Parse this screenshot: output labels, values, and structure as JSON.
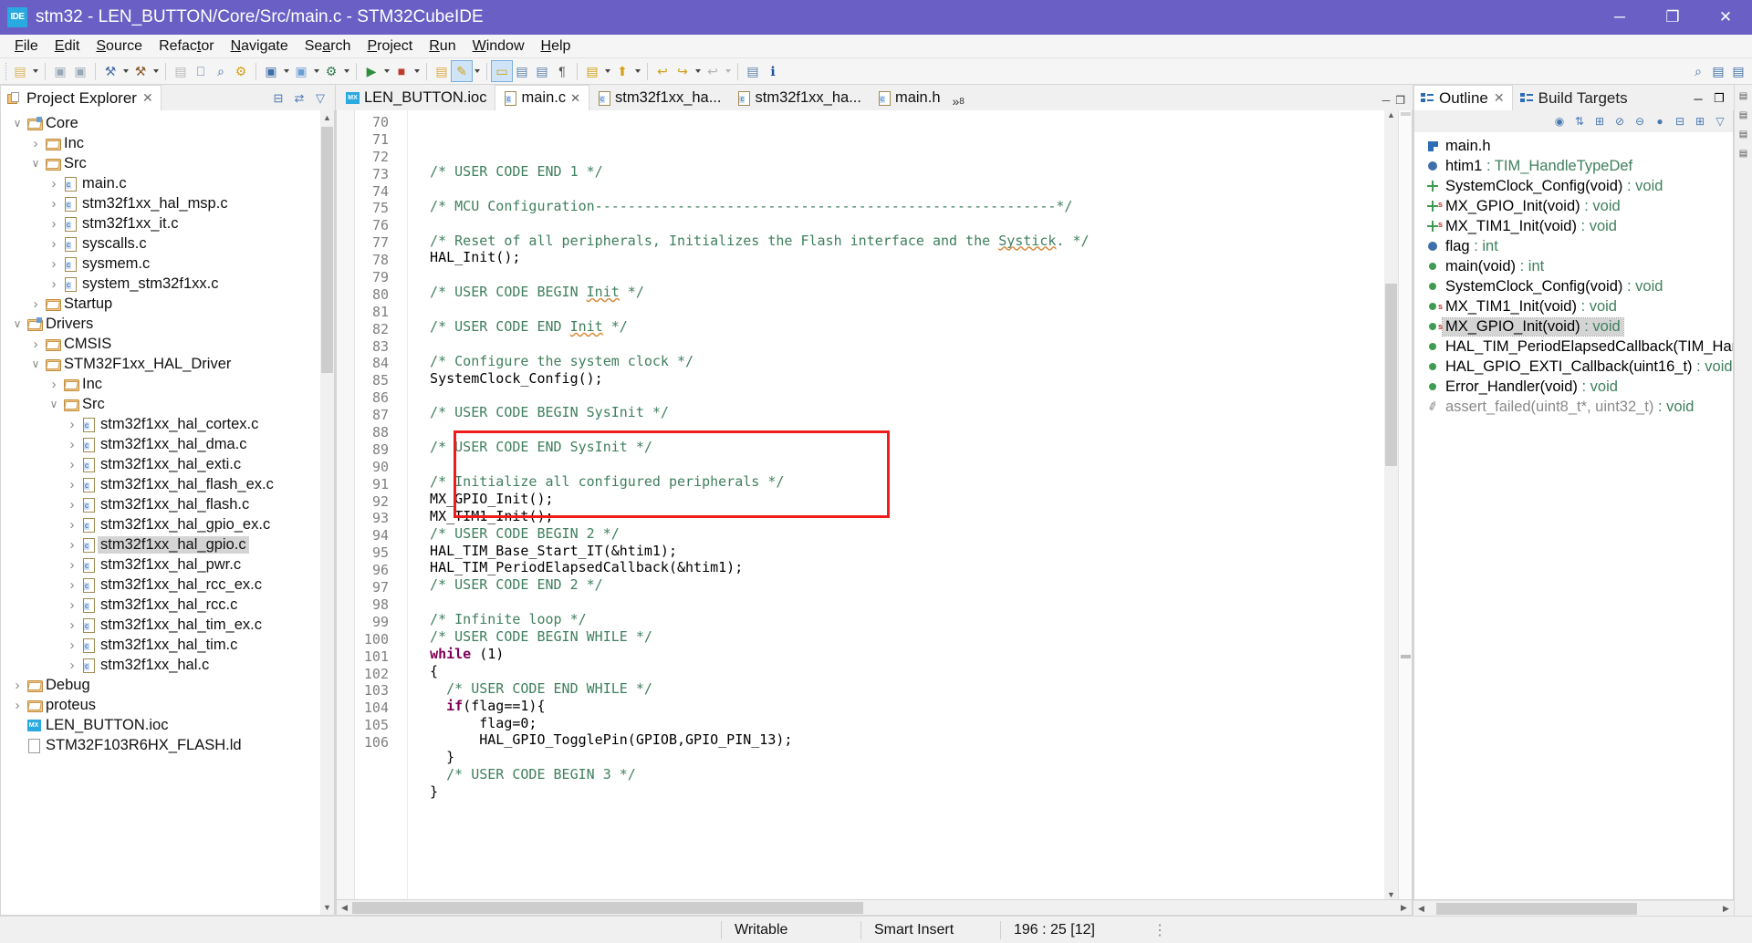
{
  "window": {
    "title": "stm32 - LEN_BUTTON/Core/Src/main.c - STM32CubeIDE",
    "logo_text": "IDE",
    "minimize": "─",
    "maximize": "❐",
    "close": "✕"
  },
  "menubar": [
    {
      "label": "File",
      "mnemonic": "F"
    },
    {
      "label": "Edit",
      "mnemonic": "E"
    },
    {
      "label": "Source",
      "mnemonic": "S"
    },
    {
      "label": "Refactor",
      "mnemonic": "t"
    },
    {
      "label": "Navigate",
      "mnemonic": "N"
    },
    {
      "label": "Search",
      "mnemonic": "a"
    },
    {
      "label": "Project",
      "mnemonic": "P"
    },
    {
      "label": "Run",
      "mnemonic": "R"
    },
    {
      "label": "Window",
      "mnemonic": "W"
    },
    {
      "label": "Help",
      "mnemonic": "H"
    }
  ],
  "toolbar": {
    "items": [
      {
        "name": "new-c-c++-project",
        "glyph": "▤",
        "color": "#d9b35c",
        "arrow": true
      },
      {
        "name": "save",
        "glyph": "▣",
        "color": "#9aa7b5",
        "arrow": false
      },
      {
        "name": "save-all",
        "glyph": "▣",
        "color": "#9aa7b5",
        "arrow": false
      },
      {
        "name": "build-all",
        "glyph": "⚒",
        "color": "#4a6fa5",
        "arrow": true
      },
      {
        "name": "build-hammer",
        "glyph": "⚒",
        "color": "#8a5a2b",
        "arrow": true
      },
      {
        "name": "new-file",
        "glyph": "▤",
        "color": "#b7b7b7",
        "arrow": false
      },
      {
        "name": "binary-010",
        "glyph": "⎕",
        "color": "#5577aa",
        "arrow": false
      },
      {
        "name": "search",
        "glyph": "⌕",
        "color": "#3f6fa8",
        "arrow": false
      },
      {
        "name": "build-config",
        "glyph": "⚙",
        "color": "#d4a017",
        "arrow": false
      },
      {
        "name": "open-element",
        "glyph": "▣",
        "color": "#3f6fa8",
        "arrow": true
      },
      {
        "name": "debug-config",
        "glyph": "▣",
        "color": "#6b9fd4",
        "arrow": true
      },
      {
        "name": "debug-bug",
        "glyph": "⚙",
        "color": "#2f7d4f",
        "arrow": true
      },
      {
        "name": "run",
        "glyph": "▶",
        "color": "#2f8f3f",
        "arrow": true
      },
      {
        "name": "stop",
        "glyph": "■",
        "color": "#c0392b",
        "arrow": true
      },
      {
        "name": "open-folder",
        "glyph": "▤",
        "color": "#e0a93f",
        "arrow": false
      },
      {
        "name": "pencil-edit",
        "glyph": "✎",
        "color": "#d4a017",
        "arrow": true
      },
      {
        "name": "toggle-comment",
        "glyph": "▭",
        "color": "#d4a017",
        "arrow": false
      },
      {
        "name": "next-annotation",
        "glyph": "▤",
        "color": "#5b7fa8",
        "arrow": false
      },
      {
        "name": "prev-annotation",
        "glyph": "▤",
        "color": "#5b7fa8",
        "arrow": false
      },
      {
        "name": "show-whitespace",
        "glyph": "¶",
        "color": "#555",
        "arrow": false
      },
      {
        "name": "skip-breakpoints",
        "glyph": "▤",
        "color": "#d4a017",
        "arrow": true
      },
      {
        "name": "resume",
        "glyph": "⬆",
        "color": "#d4a017",
        "arrow": true
      },
      {
        "name": "back-nav",
        "glyph": "↩",
        "color": "#d4a017",
        "arrow": false
      },
      {
        "name": "forward-nav",
        "glyph": "↪",
        "color": "#d4a017",
        "arrow": true
      },
      {
        "name": "last-edit",
        "glyph": "↩",
        "color": "#b5b5b5",
        "arrow": true
      },
      {
        "name": "pin-editor",
        "glyph": "▤",
        "color": "#5b7fa8",
        "arrow": false
      },
      {
        "name": "information",
        "glyph": "ℹ",
        "color": "#1b4f9c",
        "arrow": false
      }
    ],
    "right_items": [
      {
        "name": "quick-access-search",
        "glyph": "⌕"
      },
      {
        "name": "perspective-c-cpp",
        "glyph": "▤"
      },
      {
        "name": "perspective-open",
        "glyph": "▤"
      }
    ]
  },
  "explorer": {
    "tab_label": "Project Explorer",
    "tab_close": "✕",
    "tools": [
      {
        "name": "collapse-all-icon",
        "glyph": "⊟"
      },
      {
        "name": "link-with-editor-icon",
        "glyph": "⇄"
      },
      {
        "name": "view-menu-filter-icon",
        "glyph": "▽"
      }
    ],
    "tree": [
      {
        "depth": 0,
        "arrow": "open",
        "icon": "project-folder",
        "label": "Core",
        "selected": false
      },
      {
        "depth": 1,
        "arrow": "closed",
        "icon": "folder",
        "label": "Inc",
        "selected": false
      },
      {
        "depth": 1,
        "arrow": "open",
        "icon": "folder",
        "label": "Src",
        "selected": false
      },
      {
        "depth": 2,
        "arrow": "closed",
        "icon": "cfile",
        "label": "main.c",
        "selected": false
      },
      {
        "depth": 2,
        "arrow": "closed",
        "icon": "cfile",
        "label": "stm32f1xx_hal_msp.c",
        "selected": false
      },
      {
        "depth": 2,
        "arrow": "closed",
        "icon": "cfile",
        "label": "stm32f1xx_it.c",
        "selected": false
      },
      {
        "depth": 2,
        "arrow": "closed",
        "icon": "cfile",
        "label": "syscalls.c",
        "selected": false
      },
      {
        "depth": 2,
        "arrow": "closed",
        "icon": "cfile",
        "label": "sysmem.c",
        "selected": false
      },
      {
        "depth": 2,
        "arrow": "closed",
        "icon": "cfile",
        "label": "system_stm32f1xx.c",
        "selected": false
      },
      {
        "depth": 1,
        "arrow": "closed",
        "icon": "folder",
        "label": "Startup",
        "selected": false
      },
      {
        "depth": 0,
        "arrow": "open",
        "icon": "project-folder",
        "label": "Drivers",
        "selected": false
      },
      {
        "depth": 1,
        "arrow": "closed",
        "icon": "folder",
        "label": "CMSIS",
        "selected": false
      },
      {
        "depth": 1,
        "arrow": "open",
        "icon": "folder",
        "label": "STM32F1xx_HAL_Driver",
        "selected": false
      },
      {
        "depth": 2,
        "arrow": "closed",
        "icon": "folder",
        "label": "Inc",
        "selected": false
      },
      {
        "depth": 2,
        "arrow": "open",
        "icon": "folder",
        "label": "Src",
        "selected": false
      },
      {
        "depth": 3,
        "arrow": "closed",
        "icon": "cfile",
        "label": "stm32f1xx_hal_cortex.c",
        "selected": false
      },
      {
        "depth": 3,
        "arrow": "closed",
        "icon": "cfile",
        "label": "stm32f1xx_hal_dma.c",
        "selected": false
      },
      {
        "depth": 3,
        "arrow": "closed",
        "icon": "cfile",
        "label": "stm32f1xx_hal_exti.c",
        "selected": false
      },
      {
        "depth": 3,
        "arrow": "closed",
        "icon": "cfile",
        "label": "stm32f1xx_hal_flash_ex.c",
        "selected": false
      },
      {
        "depth": 3,
        "arrow": "closed",
        "icon": "cfile",
        "label": "stm32f1xx_hal_flash.c",
        "selected": false
      },
      {
        "depth": 3,
        "arrow": "closed",
        "icon": "cfile",
        "label": "stm32f1xx_hal_gpio_ex.c",
        "selected": false
      },
      {
        "depth": 3,
        "arrow": "closed",
        "icon": "cfile",
        "label": "stm32f1xx_hal_gpio.c",
        "selected": true
      },
      {
        "depth": 3,
        "arrow": "closed",
        "icon": "cfile",
        "label": "stm32f1xx_hal_pwr.c",
        "selected": false
      },
      {
        "depth": 3,
        "arrow": "closed",
        "icon": "cfile",
        "label": "stm32f1xx_hal_rcc_ex.c",
        "selected": false
      },
      {
        "depth": 3,
        "arrow": "closed",
        "icon": "cfile",
        "label": "stm32f1xx_hal_rcc.c",
        "selected": false
      },
      {
        "depth": 3,
        "arrow": "closed",
        "icon": "cfile",
        "label": "stm32f1xx_hal_tim_ex.c",
        "selected": false
      },
      {
        "depth": 3,
        "arrow": "closed",
        "icon": "cfile",
        "label": "stm32f1xx_hal_tim.c",
        "selected": false
      },
      {
        "depth": 3,
        "arrow": "closed",
        "icon": "cfile",
        "label": "stm32f1xx_hal.c",
        "selected": false
      },
      {
        "depth": 0,
        "arrow": "closed",
        "icon": "folder",
        "label": "Debug",
        "selected": false
      },
      {
        "depth": 0,
        "arrow": "closed",
        "icon": "folder",
        "label": "proteus",
        "selected": false
      },
      {
        "depth": 0,
        "arrow": "none",
        "icon": "ioc",
        "label": "LEN_BUTTON.ioc",
        "selected": false
      },
      {
        "depth": 0,
        "arrow": "none",
        "icon": "gfile",
        "label": "STM32F103R6HX_FLASH.ld",
        "selected": false
      }
    ]
  },
  "editor": {
    "tabs": [
      {
        "label": "LEN_BUTTON.ioc",
        "icon": "ioc",
        "active": false,
        "dirty": false
      },
      {
        "label": "main.c",
        "icon": "cfile",
        "active": true,
        "dirty": false
      },
      {
        "label": "stm32f1xx_ha...",
        "icon": "cfile",
        "active": false,
        "dirty": false
      },
      {
        "label": "stm32f1xx_ha...",
        "icon": "cfile",
        "active": false,
        "dirty": false
      },
      {
        "label": "main.h",
        "icon": "cfile",
        "active": false,
        "dirty": false
      }
    ],
    "overflow_label": "»",
    "overflow_count": "8",
    "view_tools": [
      {
        "name": "minimize-editor-icon",
        "glyph": "─"
      },
      {
        "name": "maximize-editor-icon",
        "glyph": "❐"
      }
    ],
    "first_line": 70,
    "lines": [
      {
        "n": 70,
        "text": "  /* USER CODE END 1 */",
        "style": "comment"
      },
      {
        "n": 71,
        "text": "",
        "style": "plain"
      },
      {
        "n": 72,
        "text": "  /* MCU Configuration--------------------------------------------------------*/",
        "style": "comment"
      },
      {
        "n": 73,
        "text": "",
        "style": "plain"
      },
      {
        "n": 74,
        "text": "  /* Reset of all peripherals, Initializes the Flash interface and the Systick. */",
        "style": "comment-systick"
      },
      {
        "n": 75,
        "text": "  HAL_Init();",
        "style": "plain"
      },
      {
        "n": 76,
        "text": "",
        "style": "plain"
      },
      {
        "n": 77,
        "text": "  /* USER CODE BEGIN Init */",
        "style": "comment-init"
      },
      {
        "n": 78,
        "text": "",
        "style": "plain"
      },
      {
        "n": 79,
        "text": "  /* USER CODE END Init */",
        "style": "comment-init"
      },
      {
        "n": 80,
        "text": "",
        "style": "plain"
      },
      {
        "n": 81,
        "text": "  /* Configure the system clock */",
        "style": "comment"
      },
      {
        "n": 82,
        "text": "  SystemClock_Config();",
        "style": "plain"
      },
      {
        "n": 83,
        "text": "",
        "style": "plain"
      },
      {
        "n": 84,
        "text": "  /* USER CODE BEGIN SysInit */",
        "style": "comment"
      },
      {
        "n": 85,
        "text": "",
        "style": "plain"
      },
      {
        "n": 86,
        "text": "  /* USER CODE END SysInit */",
        "style": "comment"
      },
      {
        "n": 87,
        "text": "",
        "style": "plain"
      },
      {
        "n": 88,
        "text": "  /* Initialize all configured peripherals */",
        "style": "comment"
      },
      {
        "n": 89,
        "text": "  MX_GPIO_Init();",
        "style": "plain"
      },
      {
        "n": 90,
        "text": "  MX_TIM1_Init();",
        "style": "plain"
      },
      {
        "n": 91,
        "text": "  /* USER CODE BEGIN 2 */",
        "style": "comment"
      },
      {
        "n": 92,
        "text": "  HAL_TIM_Base_Start_IT(&htim1);",
        "style": "plain"
      },
      {
        "n": 93,
        "text": "  HAL_TIM_PeriodElapsedCallback(&htim1);",
        "style": "plain"
      },
      {
        "n": 94,
        "text": "  /* USER CODE END 2 */",
        "style": "comment"
      },
      {
        "n": 95,
        "text": "",
        "style": "plain"
      },
      {
        "n": 96,
        "text": "  /* Infinite loop */",
        "style": "comment"
      },
      {
        "n": 97,
        "text": "  /* USER CODE BEGIN WHILE */",
        "style": "comment"
      },
      {
        "n": 98,
        "text": "  while (1)",
        "style": "keyword-while"
      },
      {
        "n": 99,
        "text": "  {",
        "style": "plain"
      },
      {
        "n": 100,
        "text": "    /* USER CODE END WHILE */",
        "style": "comment"
      },
      {
        "n": 101,
        "text": "    if(flag==1){",
        "style": "keyword-if"
      },
      {
        "n": 102,
        "text": "        flag=0;",
        "style": "plain"
      },
      {
        "n": 103,
        "text": "        HAL_GPIO_TogglePin(GPIOB,GPIO_PIN_13);",
        "style": "plain"
      },
      {
        "n": 104,
        "text": "    }",
        "style": "plain"
      },
      {
        "n": 105,
        "text": "    /* USER CODE BEGIN 3 */",
        "style": "comment"
      },
      {
        "n": 106,
        "text": "  }",
        "style": "plain"
      }
    ],
    "annotation": {
      "name": "red-highlight-box",
      "color": "#ee1c1c",
      "covers_lines": "101-105"
    }
  },
  "outline": {
    "tabs": [
      {
        "label": "Outline",
        "active": true,
        "icon": "outline-icon",
        "close": "✕"
      },
      {
        "label": "Build Targets",
        "active": false,
        "icon": "build-targets-icon",
        "close": ""
      }
    ],
    "tools": [
      {
        "name": "minimize-outline-icon",
        "glyph": "─"
      },
      {
        "name": "maximize-outline-icon",
        "glyph": "❐"
      }
    ],
    "toolbar_icons": [
      {
        "name": "focus-on-active-task-icon",
        "glyph": "◉"
      },
      {
        "name": "sort-icon",
        "glyph": "⇅"
      },
      {
        "name": "hide-fields-icon",
        "glyph": "⊞"
      },
      {
        "name": "hide-static-icon",
        "glyph": "⊘"
      },
      {
        "name": "hide-non-public-icon",
        "glyph": "⊖"
      },
      {
        "name": "show-groups-icon",
        "glyph": "●"
      },
      {
        "name": "collapse-all-icon",
        "glyph": "⊟"
      },
      {
        "name": "expand-all-icon",
        "glyph": "⊞"
      },
      {
        "name": "view-menu-icon",
        "glyph": "▽"
      }
    ],
    "items": [
      {
        "icon": "include",
        "name_text": "main.h",
        "type_text": "",
        "static": false,
        "selected": false
      },
      {
        "icon": "variable-blue",
        "name_text": "htim1 ",
        "type_text": ": TIM_HandleTypeDef",
        "static": false,
        "selected": false
      },
      {
        "icon": "prototype",
        "name_text": "SystemClock_Config(void) ",
        "type_text": ": void",
        "static": false,
        "selected": false
      },
      {
        "icon": "prototype",
        "name_text": "MX_GPIO_Init(void) ",
        "type_text": ": void",
        "static": true,
        "selected": false
      },
      {
        "icon": "prototype",
        "name_text": "MX_TIM1_Init(void) ",
        "type_text": ": void",
        "static": true,
        "selected": false
      },
      {
        "icon": "variable-blue",
        "name_text": "flag ",
        "type_text": ": int",
        "static": false,
        "selected": false
      },
      {
        "icon": "function-green",
        "name_text": "main(void) ",
        "type_text": ": int",
        "static": false,
        "selected": false
      },
      {
        "icon": "function-green",
        "name_text": "SystemClock_Config(void) ",
        "type_text": ": void",
        "static": false,
        "selected": false
      },
      {
        "icon": "function-green",
        "name_text": "MX_TIM1_Init(void) ",
        "type_text": ": void",
        "static": true,
        "selected": false
      },
      {
        "icon": "function-green",
        "name_text": "MX_GPIO_Init(void) ",
        "type_text": ": void",
        "static": true,
        "selected": true
      },
      {
        "icon": "function-green",
        "name_text": "HAL_TIM_PeriodElapsedCallback(TIM_Han",
        "type_text": "",
        "static": false,
        "selected": false
      },
      {
        "icon": "function-green",
        "name_text": "HAL_GPIO_EXTI_Callback(uint16_t) ",
        "type_text": ": void",
        "static": false,
        "selected": false
      },
      {
        "icon": "function-green",
        "name_text": "Error_Handler(void) ",
        "type_text": ": void",
        "static": false,
        "selected": false
      },
      {
        "icon": "pencil",
        "name_text": "assert_failed(uint8_t*, uint32_t) ",
        "type_text": ": void",
        "static": false,
        "selected": false,
        "greyed": true
      }
    ]
  },
  "rail": [
    {
      "name": "restore-perspective-icon",
      "glyph": "▤"
    },
    {
      "name": "minimized-view-icon-1",
      "glyph": "▤"
    },
    {
      "name": "minimized-view-icon-2",
      "glyph": "▤"
    },
    {
      "name": "minimized-view-icon-3",
      "glyph": "▤"
    }
  ],
  "statusbar": {
    "writable": "Writable",
    "insert_mode": "Smart Insert",
    "position": "196 : 25 [12]",
    "drag_handle": "⋮"
  }
}
